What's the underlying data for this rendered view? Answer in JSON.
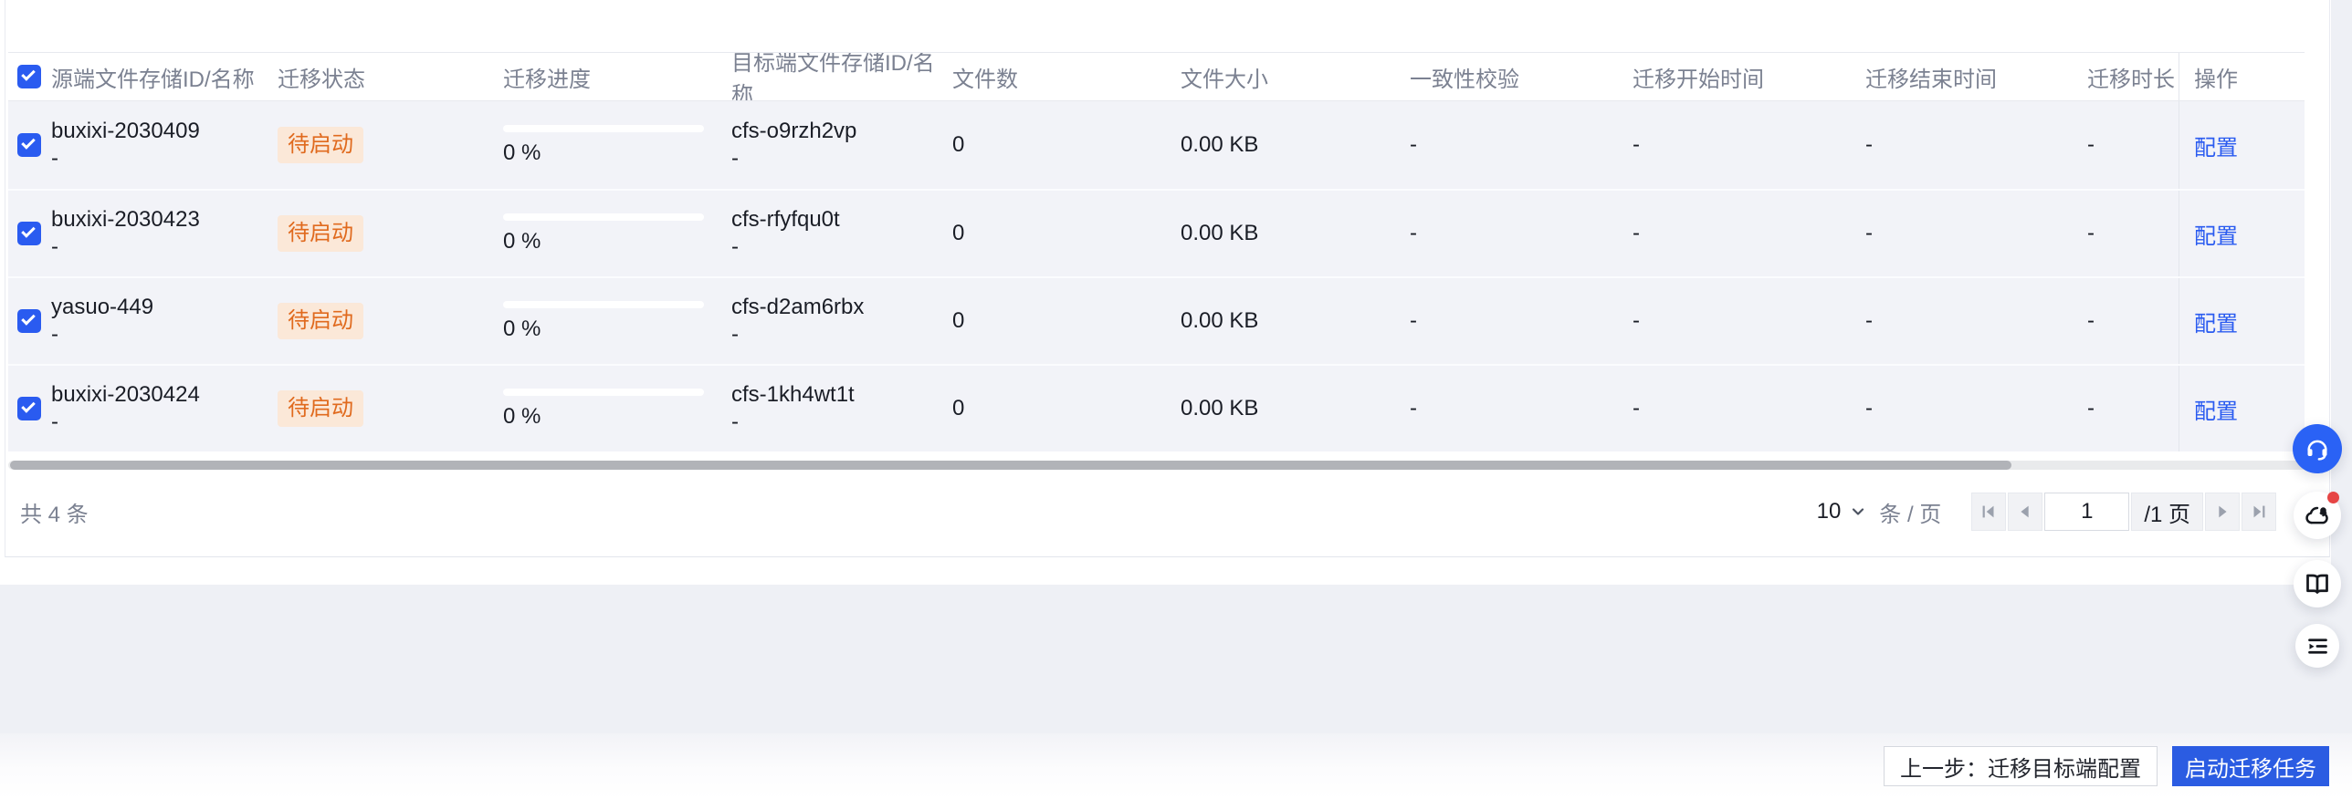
{
  "table": {
    "select_all_checked": true,
    "columns": [
      "源端文件存储ID/名称",
      "迁移状态",
      "迁移进度",
      "目标端文件存储ID/名称",
      "文件数",
      "文件大小",
      "一致性校验",
      "迁移开始时间",
      "迁移结束时间",
      "迁移时长",
      "操作"
    ],
    "rows": [
      {
        "checked": true,
        "source_id": "buxixi-2030409",
        "source_name": "-",
        "status": "待启动",
        "progress_label": "0 %",
        "progress_percent": 0,
        "target_id": "cfs-o9rzh2vp",
        "target_name": "-",
        "file_count": "0",
        "file_size": "0.00 KB",
        "consistency": "-",
        "start_time": "-",
        "end_time": "-",
        "duration": "-",
        "action_label": "配置"
      },
      {
        "checked": true,
        "source_id": "buxixi-2030423",
        "source_name": "-",
        "status": "待启动",
        "progress_label": "0 %",
        "progress_percent": 0,
        "target_id": "cfs-rfyfqu0t",
        "target_name": "-",
        "file_count": "0",
        "file_size": "0.00 KB",
        "consistency": "-",
        "start_time": "-",
        "end_time": "-",
        "duration": "-",
        "action_label": "配置"
      },
      {
        "checked": true,
        "source_id": "yasuo-449",
        "source_name": "-",
        "status": "待启动",
        "progress_label": "0 %",
        "progress_percent": 0,
        "target_id": "cfs-d2am6rbx",
        "target_name": "-",
        "file_count": "0",
        "file_size": "0.00 KB",
        "consistency": "-",
        "start_time": "-",
        "end_time": "-",
        "duration": "-",
        "action_label": "配置"
      },
      {
        "checked": true,
        "source_id": "buxixi-2030424",
        "source_name": "-",
        "status": "待启动",
        "progress_label": "0 %",
        "progress_percent": 0,
        "target_id": "cfs-1kh4wt1t",
        "target_name": "-",
        "file_count": "0",
        "file_size": "0.00 KB",
        "consistency": "-",
        "start_time": "-",
        "end_time": "-",
        "duration": "-",
        "action_label": "配置"
      }
    ]
  },
  "pagination": {
    "total_text": "共 4 条",
    "page_size": "10",
    "unit_label": "条 / 页",
    "current_page": "1",
    "total_pages_label": "/1 页"
  },
  "footer": {
    "prev_label": "上一步：迁移目标端配置",
    "start_label": "启动迁移任务"
  },
  "floating_buttons": [
    {
      "icon": "headset-icon",
      "style": "primary"
    },
    {
      "icon": "cloud-bell-icon",
      "has_red_dot": true
    },
    {
      "icon": "open-book-icon"
    },
    {
      "icon": "feedback-list-icon"
    }
  ],
  "colors": {
    "accent_blue": "#2a5bf0",
    "primary_button_blue": "#2b5ce2",
    "badge_bg": "#fbe8d8",
    "badge_text": "#e06a1e",
    "row_selected_bg": "#f2f3f8",
    "page_bg": "#eef0f5"
  }
}
